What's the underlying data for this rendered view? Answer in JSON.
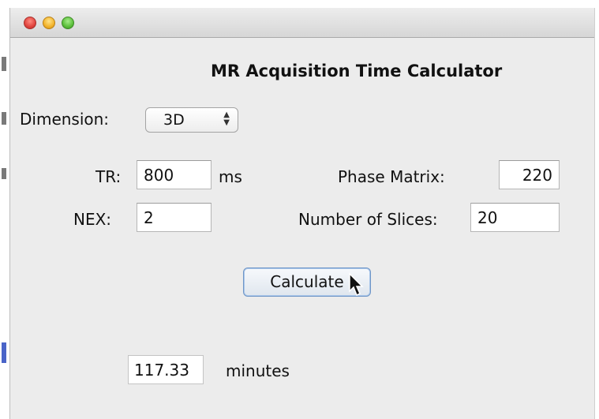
{
  "app": {
    "title": "MR Acquisition Time Calculator"
  },
  "dimension": {
    "label": "Dimension:",
    "value": "3D"
  },
  "tr": {
    "label": "TR:",
    "value": "800",
    "unit": "ms"
  },
  "nex": {
    "label": "NEX:",
    "value": "2"
  },
  "phase_matrix": {
    "label": "Phase Matrix:",
    "value": "220"
  },
  "slices": {
    "label": "Number of Slices:",
    "value": "20"
  },
  "calculate_button": {
    "label": "Calculate"
  },
  "result": {
    "value": "117.33",
    "unit": "minutes"
  }
}
